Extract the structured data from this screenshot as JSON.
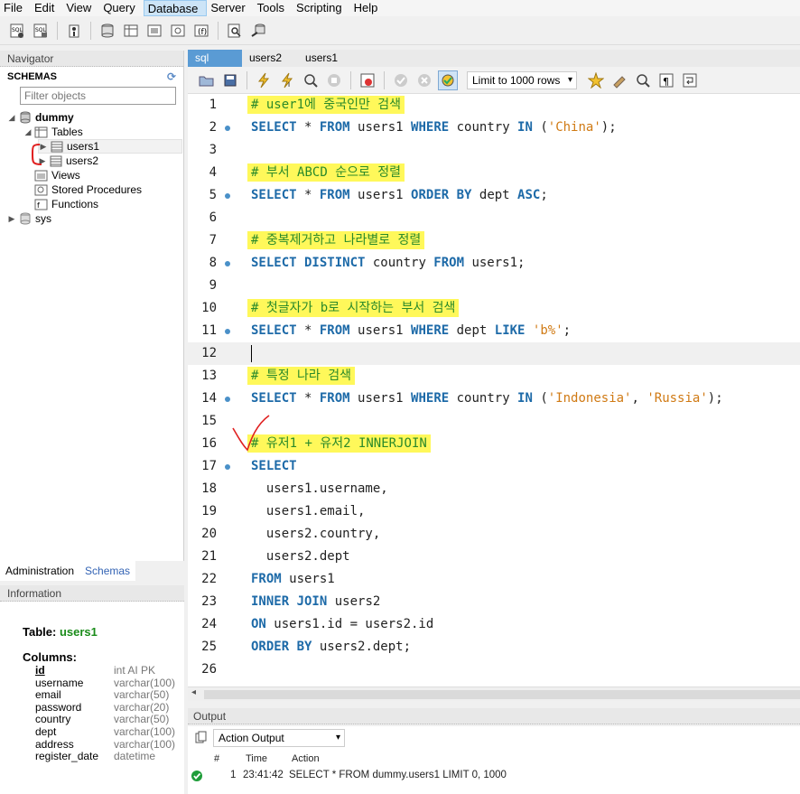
{
  "menu": [
    "File",
    "Edit",
    "View",
    "Query",
    "Database",
    "Server",
    "Tools",
    "Scripting",
    "Help"
  ],
  "menu_active": "Database",
  "navigator": {
    "title": "Navigator",
    "schemas_label": "SCHEMAS",
    "filter_placeholder": "Filter objects",
    "tree": [
      {
        "label": "dummy",
        "bold": true
      },
      {
        "label": "Tables"
      },
      {
        "label": "users1"
      },
      {
        "label": "users2"
      },
      {
        "label": "Views"
      },
      {
        "label": "Stored Procedures"
      },
      {
        "label": "Functions"
      },
      {
        "label": "sys"
      }
    ]
  },
  "bottom_tabs": {
    "administration": "Administration",
    "schemas": "Schemas"
  },
  "information": {
    "title": "Information",
    "table_label": "Table:",
    "table_name": "users1",
    "columns_label": "Columns:",
    "columns": [
      {
        "name": "id",
        "type": "int AI PK"
      },
      {
        "name": "username",
        "type": "varchar(100)"
      },
      {
        "name": "email",
        "type": "varchar(50)"
      },
      {
        "name": "password",
        "type": "varchar(20)"
      },
      {
        "name": "country",
        "type": "varchar(50)"
      },
      {
        "name": "dept",
        "type": "varchar(100)"
      },
      {
        "name": "address",
        "type": "varchar(100)"
      },
      {
        "name": "register_date",
        "type": "datetime"
      }
    ]
  },
  "editor_tabs": [
    "sql",
    "users2",
    "users1"
  ],
  "editor_toolbar": {
    "limit": "Limit to 1000 rows"
  },
  "code_lines": [
    {
      "n": "1",
      "dot": false,
      "comment": "# user1에 중국인만 검색"
    },
    {
      "n": "2",
      "dot": true,
      "parts": [
        [
          "kw",
          "SELECT"
        ],
        [
          "t",
          " * "
        ],
        [
          "kw",
          "FROM"
        ],
        [
          "t",
          " users1 "
        ],
        [
          "kw",
          "WHERE"
        ],
        [
          "t",
          " country "
        ],
        [
          "kw",
          "IN"
        ],
        [
          "t",
          " ("
        ],
        [
          "str",
          "'China'"
        ],
        [
          "t",
          ");"
        ]
      ]
    },
    {
      "n": "3",
      "dot": false,
      "parts": []
    },
    {
      "n": "4",
      "dot": false,
      "comment": "# 부서 ABCD 순으로 정렬"
    },
    {
      "n": "5",
      "dot": true,
      "parts": [
        [
          "kw",
          "SELECT"
        ],
        [
          "t",
          " * "
        ],
        [
          "kw",
          "FROM"
        ],
        [
          "t",
          " users1 "
        ],
        [
          "kw",
          "ORDER BY"
        ],
        [
          "t",
          " dept "
        ],
        [
          "kw",
          "ASC"
        ],
        [
          "t",
          ";"
        ]
      ]
    },
    {
      "n": "6",
      "dot": false,
      "parts": []
    },
    {
      "n": "7",
      "dot": false,
      "comment": "# 중복제거하고 나라별로 정렬"
    },
    {
      "n": "8",
      "dot": true,
      "parts": [
        [
          "kw",
          "SELECT DISTINCT"
        ],
        [
          "t",
          " country "
        ],
        [
          "kw",
          "FROM"
        ],
        [
          "t",
          " users1;"
        ]
      ]
    },
    {
      "n": "9",
      "dot": false,
      "parts": []
    },
    {
      "n": "10",
      "dot": false,
      "comment": "# 첫글자가 b로 시작하는 부서 검색"
    },
    {
      "n": "11",
      "dot": true,
      "parts": [
        [
          "kw",
          "SELECT"
        ],
        [
          "t",
          " * "
        ],
        [
          "kw",
          "FROM"
        ],
        [
          "t",
          " users1 "
        ],
        [
          "kw",
          "WHERE"
        ],
        [
          "t",
          " dept "
        ],
        [
          "kw",
          "LIKE"
        ],
        [
          "t",
          " "
        ],
        [
          "str",
          "'b%'"
        ],
        [
          "t",
          ";"
        ]
      ]
    },
    {
      "n": "12",
      "dot": false,
      "parts": [],
      "current": true
    },
    {
      "n": "13",
      "dot": false,
      "comment": "# 특정 나라 검색"
    },
    {
      "n": "14",
      "dot": true,
      "parts": [
        [
          "kw",
          "SELECT"
        ],
        [
          "t",
          " * "
        ],
        [
          "kw",
          "FROM"
        ],
        [
          "t",
          " users1 "
        ],
        [
          "kw",
          "WHERE"
        ],
        [
          "t",
          " country "
        ],
        [
          "kw",
          "IN"
        ],
        [
          "t",
          " ("
        ],
        [
          "str",
          "'Indonesia'"
        ],
        [
          "t",
          ", "
        ],
        [
          "str",
          "'Russia'"
        ],
        [
          "t",
          ");"
        ]
      ]
    },
    {
      "n": "15",
      "dot": false,
      "parts": []
    },
    {
      "n": "16",
      "dot": false,
      "comment": "# 유저1 + 유저2 INNERJOIN"
    },
    {
      "n": "17",
      "dot": true,
      "parts": [
        [
          "kw",
          "SELECT"
        ]
      ]
    },
    {
      "n": "18",
      "dot": false,
      "parts": [
        [
          "t",
          "  users1.username,"
        ]
      ]
    },
    {
      "n": "19",
      "dot": false,
      "parts": [
        [
          "t",
          "  users1.email,"
        ]
      ]
    },
    {
      "n": "20",
      "dot": false,
      "parts": [
        [
          "t",
          "  users2.country,"
        ]
      ]
    },
    {
      "n": "21",
      "dot": false,
      "parts": [
        [
          "t",
          "  users2.dept"
        ]
      ]
    },
    {
      "n": "22",
      "dot": false,
      "parts": [
        [
          "kw",
          "FROM"
        ],
        [
          "t",
          " users1"
        ]
      ]
    },
    {
      "n": "23",
      "dot": false,
      "parts": [
        [
          "kw",
          "INNER JOIN"
        ],
        [
          "t",
          " users2"
        ]
      ]
    },
    {
      "n": "24",
      "dot": false,
      "parts": [
        [
          "kw",
          "ON"
        ],
        [
          "t",
          " users1.id = users2.id"
        ]
      ]
    },
    {
      "n": "25",
      "dot": false,
      "parts": [
        [
          "kw",
          "ORDER BY"
        ],
        [
          "t",
          " users2.dept;"
        ]
      ]
    },
    {
      "n": "26",
      "dot": false,
      "parts": []
    }
  ],
  "output": {
    "title": "Output",
    "mode": "Action Output",
    "headers": {
      "num": "#",
      "time": "Time",
      "action": "Action"
    },
    "row": {
      "num": "1",
      "time": "23:41:42",
      "action": "SELECT * FROM dummy.users1 LIMIT 0, 1000"
    }
  },
  "colors": {
    "keyword": "#1d6aa8",
    "string": "#d07a14",
    "comment": "#2a8a2a",
    "highlight": "#fff85a",
    "annotation": "#e02020"
  }
}
